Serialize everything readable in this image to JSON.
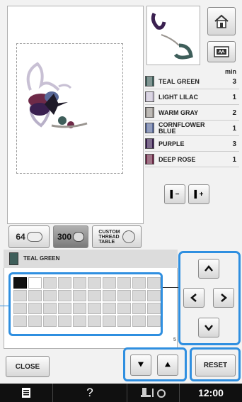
{
  "colors": {
    "accent": "#2f8fe0",
    "background": "#f2f2f2",
    "status_bar": "#101010"
  },
  "header": {
    "home_icon": "home-icon",
    "frame_icon": "embroidery-frame-icon"
  },
  "color_list": {
    "min_label": "min",
    "items": [
      {
        "name": "TEAL GREEN",
        "minutes": "3",
        "color": "#3e5e5a"
      },
      {
        "name": "LIGHT LILAC",
        "minutes": "1",
        "color": "#c8c0d4"
      },
      {
        "name": "WARM GRAY",
        "minutes": "2",
        "color": "#9a9590"
      },
      {
        "name": "CORNFLOWER BLUE",
        "minutes": "1",
        "color": "#5a6a9a"
      },
      {
        "name": "PURPLE",
        "minutes": "3",
        "color": "#3a2050"
      },
      {
        "name": "DEEP ROSE",
        "minutes": "1",
        "color": "#6e2a48"
      }
    ]
  },
  "nav": {
    "prev_label": "▌−",
    "next_label": "▌+"
  },
  "tabs": {
    "tab_64": "64",
    "tab_300": "300",
    "custom_line1": "CUSTOM",
    "custom_line2": "THREAD",
    "custom_line3": "TABLE"
  },
  "selected_color": {
    "name": "TEAL GREEN"
  },
  "grid": {
    "page_indicator": "5"
  },
  "buttons": {
    "close": "CLOSE",
    "reset": "RESET",
    "scroll_down": "⯆",
    "scroll_up": "⯅"
  },
  "status_bar": {
    "time": "12:00",
    "help": "?"
  }
}
